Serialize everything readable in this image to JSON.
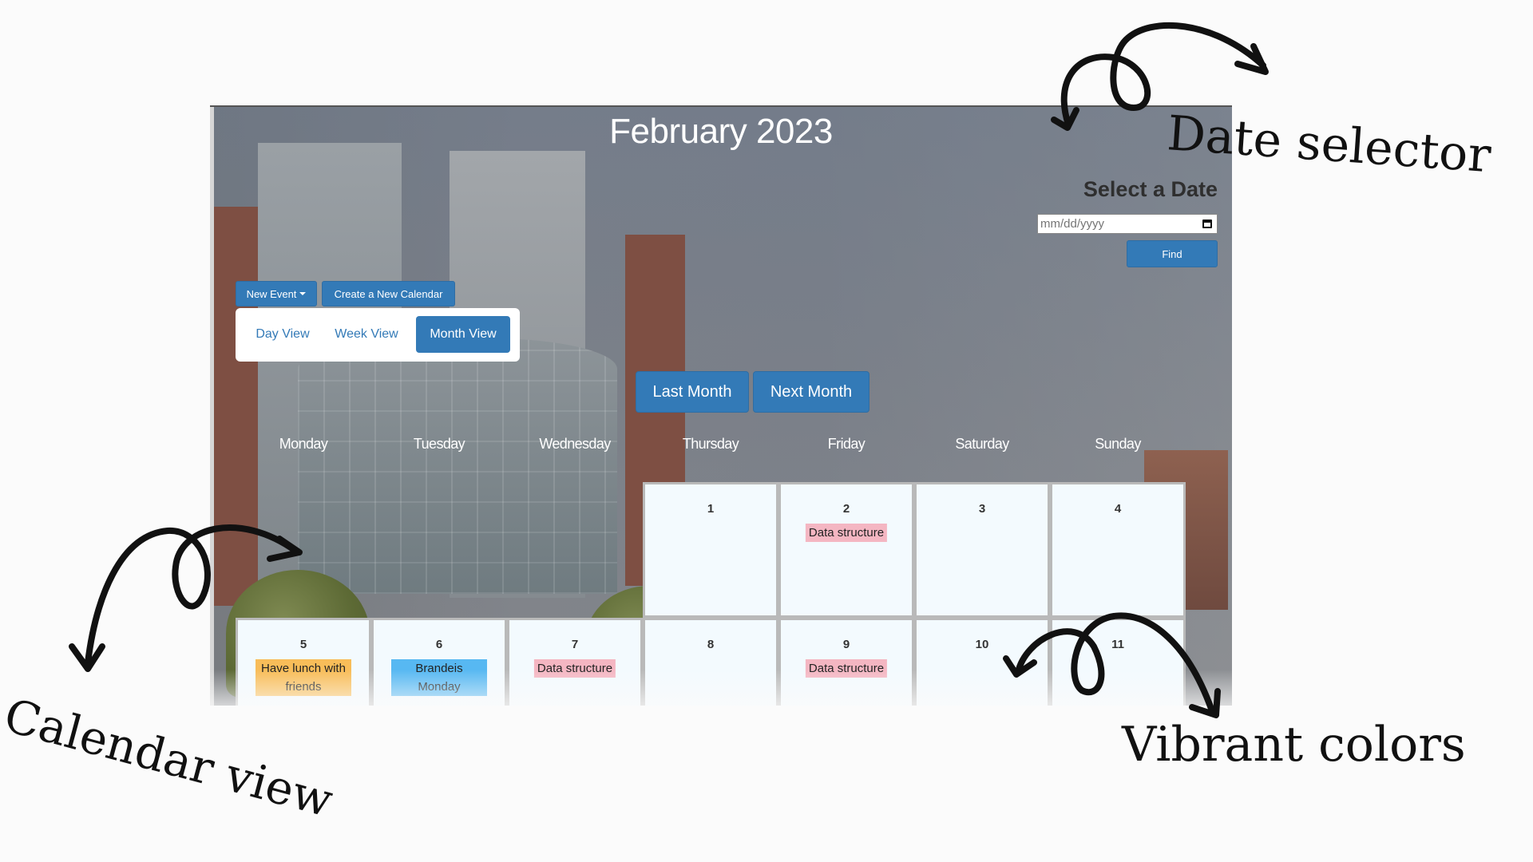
{
  "calendar": {
    "title": "February 2023",
    "date_selector": {
      "label": "Select a Date",
      "placeholder": "mm/dd/yyyy",
      "find_label": "Find"
    },
    "toolbar": {
      "new_event_label": "New Event",
      "new_calendar_label": "Create a New Calendar"
    },
    "views": {
      "day": "Day View",
      "week": "Week View",
      "month": "Month View",
      "active": "Month View"
    },
    "nav": {
      "last_month": "Last Month",
      "next_month": "Next Month"
    },
    "weekdays": [
      "Monday",
      "Tuesday",
      "Wednesday",
      "Thursday",
      "Friday",
      "Saturday",
      "Sunday"
    ],
    "days": [
      {
        "num": "1",
        "event": ""
      },
      {
        "num": "2",
        "event": "Data structure",
        "color": "pink"
      },
      {
        "num": "3",
        "event": ""
      },
      {
        "num": "4",
        "event": ""
      },
      {
        "num": "5",
        "event": "Have lunch with friends",
        "color": "orange"
      },
      {
        "num": "6",
        "event": "Brandeis Monday",
        "color": "blue"
      },
      {
        "num": "7",
        "event": "Data structure",
        "color": "pink"
      },
      {
        "num": "8",
        "event": ""
      },
      {
        "num": "9",
        "event": "Data structure",
        "color": "pink"
      },
      {
        "num": "10",
        "event": ""
      },
      {
        "num": "11",
        "event": ""
      }
    ],
    "colors": {
      "primary": "#337ab7",
      "pink": "#f4b6c2",
      "orange": "#f8bd59",
      "blue": "#57b8f2"
    }
  },
  "annotations": {
    "date_selector": "Date selector",
    "calendar_view": "Calendar view",
    "vibrant_colors": "Vibrant colors"
  }
}
